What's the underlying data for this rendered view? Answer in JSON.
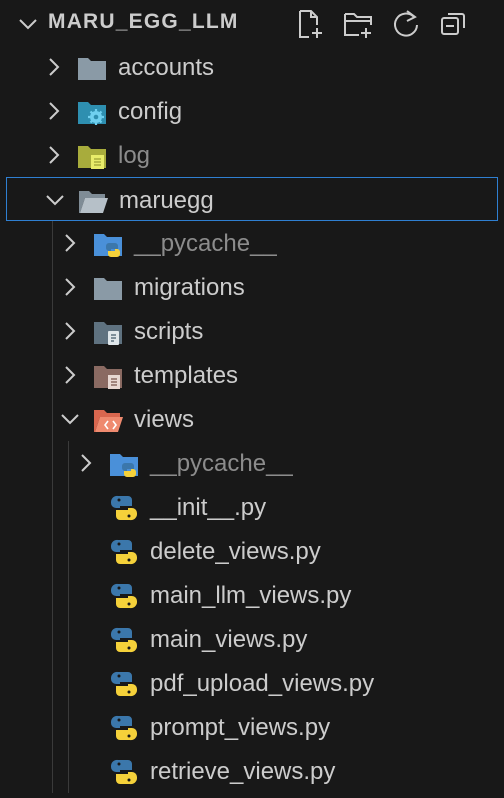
{
  "explorer": {
    "root_title": "MARU_EGG_LLM",
    "actions": [
      {
        "name": "new-file-icon"
      },
      {
        "name": "new-folder-icon"
      },
      {
        "name": "refresh-icon"
      },
      {
        "name": "collapse-all-icon"
      }
    ],
    "items": [
      {
        "label": "accounts",
        "type": "folder",
        "icon": "folder-icon",
        "expanded": false,
        "depth": 0,
        "dim": false
      },
      {
        "label": "config",
        "type": "folder",
        "icon": "folder-config-icon",
        "expanded": false,
        "depth": 0,
        "dim": false
      },
      {
        "label": "log",
        "type": "folder",
        "icon": "folder-log-icon",
        "expanded": false,
        "depth": 0,
        "dim": true
      },
      {
        "label": "maruegg",
        "type": "folder",
        "icon": "folder-open-icon",
        "expanded": true,
        "depth": 0,
        "dim": false,
        "selected": true
      },
      {
        "label": "__pycache__",
        "type": "folder",
        "icon": "folder-python-icon",
        "expanded": false,
        "depth": 1,
        "dim": true
      },
      {
        "label": "migrations",
        "type": "folder",
        "icon": "folder-icon",
        "expanded": false,
        "depth": 1,
        "dim": false
      },
      {
        "label": "scripts",
        "type": "folder",
        "icon": "folder-scripts-icon",
        "expanded": false,
        "depth": 1,
        "dim": false
      },
      {
        "label": "templates",
        "type": "folder",
        "icon": "folder-templates-icon",
        "expanded": false,
        "depth": 1,
        "dim": false
      },
      {
        "label": "views",
        "type": "folder",
        "icon": "folder-views-icon",
        "expanded": true,
        "depth": 1,
        "dim": false
      },
      {
        "label": "__pycache__",
        "type": "folder",
        "icon": "folder-python-icon",
        "expanded": false,
        "depth": 2,
        "dim": true
      },
      {
        "label": "__init__.py",
        "type": "file",
        "icon": "python-file-icon",
        "depth": 2,
        "dim": false
      },
      {
        "label": "delete_views.py",
        "type": "file",
        "icon": "python-file-icon",
        "depth": 2,
        "dim": false
      },
      {
        "label": "main_llm_views.py",
        "type": "file",
        "icon": "python-file-icon",
        "depth": 2,
        "dim": false
      },
      {
        "label": "main_views.py",
        "type": "file",
        "icon": "python-file-icon",
        "depth": 2,
        "dim": false
      },
      {
        "label": "pdf_upload_views.py",
        "type": "file",
        "icon": "python-file-icon",
        "depth": 2,
        "dim": false
      },
      {
        "label": "prompt_views.py",
        "type": "file",
        "icon": "python-file-icon",
        "depth": 2,
        "dim": false
      },
      {
        "label": "retrieve_views.py",
        "type": "file",
        "icon": "python-file-icon",
        "depth": 2,
        "dim": false
      }
    ],
    "colors": {
      "background": "#181818",
      "text": "#cccccc",
      "dim_text": "#8c8c8c",
      "selection_border": "#2f7fd1",
      "folder_gray": "#8a9aa6",
      "folder_blue": "#4a90d9",
      "python_blue": "#3b77ab",
      "python_yellow": "#f5d13a"
    }
  }
}
